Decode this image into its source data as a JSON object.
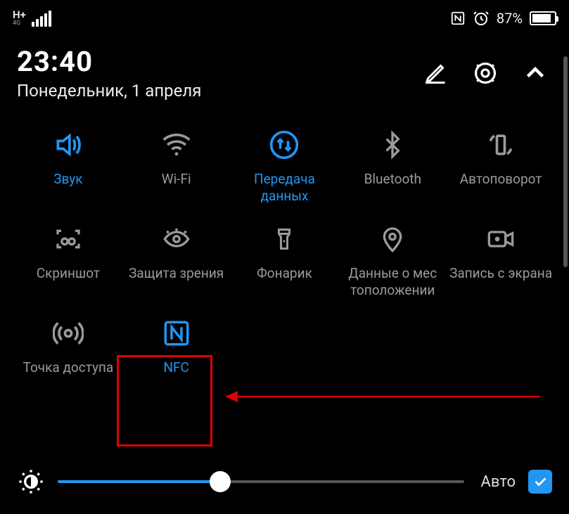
{
  "status": {
    "network_type": "H+",
    "sub_network": "4G",
    "nfc_on": true,
    "alarm_on": true,
    "battery_pct": "87%",
    "battery_fill_pct": 87
  },
  "header": {
    "time": "23:40",
    "date": "Понедельник, 1 апреля"
  },
  "tiles": [
    {
      "id": "sound",
      "label": "Звук",
      "icon": "volume",
      "active": true
    },
    {
      "id": "wifi",
      "label": "Wi-Fi",
      "icon": "wifi",
      "active": false
    },
    {
      "id": "mobiledata",
      "label": "Передача данных",
      "icon": "data",
      "active": true
    },
    {
      "id": "bluetooth",
      "label": "Bluetooth",
      "icon": "bluetooth",
      "active": false
    },
    {
      "id": "autorotate",
      "label": "Автоповорот",
      "icon": "rotate",
      "active": false
    },
    {
      "id": "screenshot",
      "label": "Скриншот",
      "icon": "screenshot",
      "active": false
    },
    {
      "id": "eyecomfort",
      "label": "Защита зрения",
      "icon": "eye",
      "active": false
    },
    {
      "id": "flashlight",
      "label": "Фонарик",
      "icon": "flashlight",
      "active": false
    },
    {
      "id": "location",
      "label": "Данные о мес тоположении",
      "icon": "location",
      "active": false
    },
    {
      "id": "screenrec",
      "label": "Запись с экрана",
      "icon": "record",
      "active": false
    },
    {
      "id": "hotspot",
      "label": "Точка доступа",
      "icon": "hotspot",
      "active": false
    },
    {
      "id": "nfc",
      "label": "NFC",
      "icon": "nfc",
      "active": true
    }
  ],
  "brightness": {
    "value_pct": 40,
    "auto_label": "Авто",
    "auto_checked": true
  },
  "annotation": {
    "highlight_tile": "nfc"
  }
}
